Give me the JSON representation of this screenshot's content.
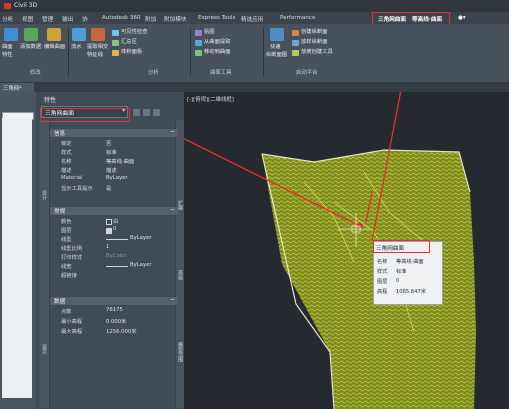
{
  "app": {
    "title": "Civil 3D"
  },
  "ribbon_tabs": [
    "分析",
    "视图",
    "管理",
    "输出",
    "协",
    "Autodesk 360",
    "附加",
    "附加模块",
    "Express Tools",
    "精选应用",
    "Performance",
    "三角网曲面",
    "等高线·曲面"
  ],
  "ribbon": {
    "buttons": {
      "surface": "曲面",
      "surface_props": "特性",
      "add_data": "添加数据",
      "edit_surface": "编辑曲面",
      "pour": "流水",
      "extract_profile": "提取相交",
      "extract_profile2": "特征线",
      "visibility": "可见性检查",
      "summary": "汇总区",
      "volume": "体积面板",
      "draw_map": "贴图",
      "from_surface": "从曲面提取",
      "move_to_surface": "移动到曲面",
      "quick_profile": "快速",
      "quick_profile2": "纵断面图",
      "create_sampleline": "创建纵断面",
      "layout_profile": "放样纵断面",
      "create_tool": "放坡创建工具"
    },
    "groups": [
      "修改",
      "分析",
      "曲面工具",
      "启动平台"
    ]
  },
  "doc_tab": "三角网*",
  "properties": {
    "title": "特性",
    "object_type": "三角网曲面",
    "sections": {
      "info": {
        "label": "信息",
        "rows": [
          {
            "key": "锁定",
            "value": "否"
          },
          {
            "key": "样式",
            "value": "标准"
          },
          {
            "key": "名称",
            "value": "等高线·曲面"
          },
          {
            "key": "描述",
            "value": "描述"
          },
          {
            "key": "Material",
            "value": "ByLayer"
          },
          {
            "key": "显示工具提示",
            "value": "是"
          }
        ]
      },
      "general": {
        "label": "常规",
        "rows": [
          {
            "key": "颜色",
            "value": "白"
          },
          {
            "key": "图层",
            "value": "0"
          },
          {
            "key": "线型",
            "value": "ByLayer"
          },
          {
            "key": "线型比例",
            "value": "1"
          },
          {
            "key": "打印样式",
            "value": "ByColor"
          },
          {
            "key": "线宽",
            "value": "ByLayer"
          },
          {
            "key": "超链接",
            "value": ""
          }
        ]
      },
      "data": {
        "label": "数据",
        "rows": [
          {
            "key": "点数",
            "value": "76175"
          },
          {
            "key": "最小高程",
            "value": "0.000米"
          },
          {
            "key": "最大高程",
            "value": "1256.000米"
          }
        ]
      }
    },
    "left_tabs": [
      "设计",
      "显示"
    ],
    "right_tabs": [
      "扩展",
      "高级",
      "模型范围"
    ]
  },
  "viewport": {
    "label": "[-][俯视][二维线框]"
  },
  "tooltip": {
    "header": "三角网曲面",
    "rows": [
      {
        "key": "名称",
        "value": "等高线·曲面"
      },
      {
        "key": "样式",
        "value": "标准"
      },
      {
        "key": "图层",
        "value": "0"
      },
      {
        "key": "高程",
        "value": "1065.647米"
      }
    ]
  },
  "colors": {
    "highlight": "#e2302a",
    "terrain": "#a9b42c",
    "boundary": "#e7e4c8"
  }
}
